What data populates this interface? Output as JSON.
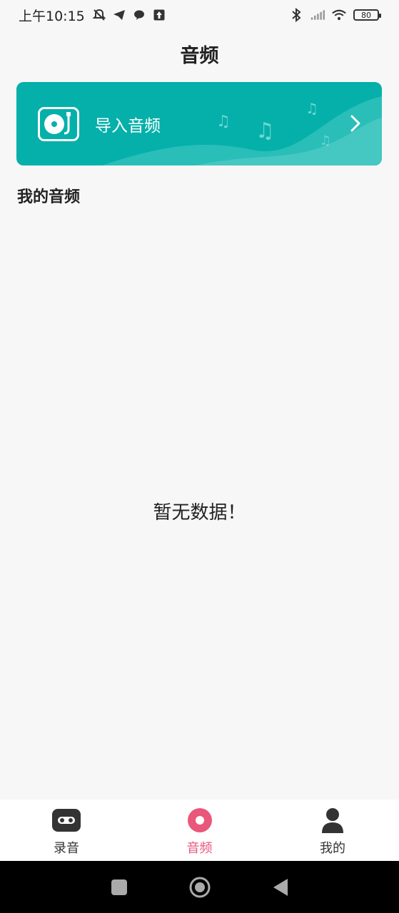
{
  "status_bar": {
    "time": "上午10:15",
    "battery": "80"
  },
  "header": {
    "title": "音频"
  },
  "import_card": {
    "label": "导入音频"
  },
  "section": {
    "title": "我的音频"
  },
  "empty_state": {
    "text": "暂无数据！"
  },
  "bottom_nav": {
    "items": [
      {
        "label": "录音",
        "icon": "cassette-icon",
        "active": false
      },
      {
        "label": "音频",
        "icon": "record-dot-icon",
        "active": true
      },
      {
        "label": "我的",
        "icon": "person-icon",
        "active": false
      }
    ],
    "active_color": "#e9577a"
  },
  "colors": {
    "card": "#05b0aa",
    "background": "#f7f7f7"
  }
}
